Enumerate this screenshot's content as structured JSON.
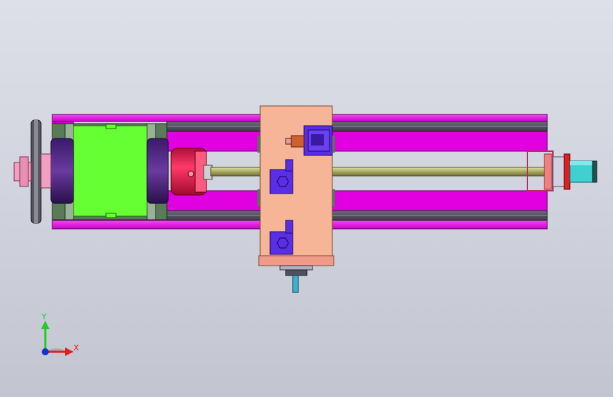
{
  "viewport": {
    "background_top": "#dde0e8",
    "background_bottom": "#c2c5d0"
  },
  "model": {
    "description_colors": {
      "frame_magenta": "#e600e6",
      "rail_dark": "#4a4a5a",
      "chuck_red": "#e8174a",
      "jaw_green": "#66ff33",
      "carriage_peach": "#f5b596",
      "block_blue": "#5a2ee6",
      "screw_olive": "#c8c878",
      "motor_cyan": "#40d0d0",
      "pulley_pink": "#f0a0c0"
    }
  },
  "triad": {
    "y_label": "Y",
    "x_label": "X",
    "y_color": "#22cc22",
    "x_color": "#e02020",
    "origin_color": "#1a2fd0"
  }
}
